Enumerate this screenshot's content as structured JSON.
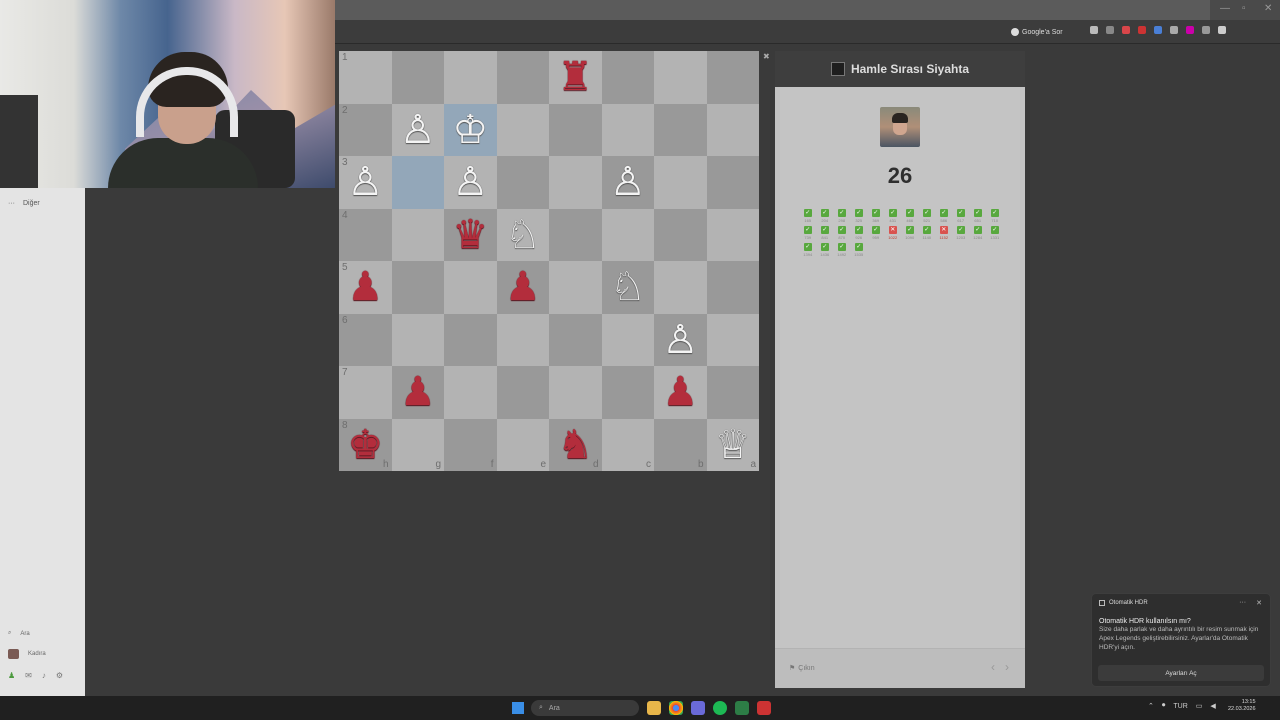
{
  "browser": {
    "google_lens_label": "Google'a Sor",
    "window_controls": [
      "—",
      "▫",
      "✕"
    ]
  },
  "sidebar": {
    "menu_label": "Diğer",
    "search_label": "Ara",
    "user_label": "Kadıra"
  },
  "board": {
    "rank_labels": [
      "1",
      "2",
      "3",
      "4",
      "5",
      "6",
      "7",
      "8"
    ],
    "file_labels": [
      "h",
      "g",
      "f",
      "e",
      "d",
      "c",
      "b",
      "a"
    ],
    "rows": [
      [
        "",
        "",
        "",
        "",
        "♜",
        "",
        "",
        ""
      ],
      [
        "",
        "♙",
        "♔",
        "",
        "",
        "",
        "",
        ""
      ],
      [
        "♙",
        "",
        "♙",
        "",
        "",
        "♙",
        "",
        ""
      ],
      [
        "",
        "",
        "♛",
        "♘",
        "",
        "",
        "",
        ""
      ],
      [
        "♟",
        "",
        "",
        "♟",
        "",
        "♘",
        "",
        ""
      ],
      [
        "",
        "",
        "",
        "",
        "",
        "",
        "♙",
        ""
      ],
      [
        "",
        "♟",
        "",
        "",
        "",
        "",
        "♟",
        ""
      ],
      [
        "♚",
        "",
        "",
        "",
        "♞",
        "",
        "",
        "♕"
      ]
    ],
    "colors": [
      [
        "",
        "",
        "",
        "",
        "b",
        "",
        "",
        ""
      ],
      [
        "",
        "w",
        "w",
        "",
        "",
        "",
        "",
        ""
      ],
      [
        "w",
        "",
        "w",
        "",
        "",
        "w",
        "",
        ""
      ],
      [
        "",
        "",
        "b",
        "w",
        "",
        "",
        "",
        ""
      ],
      [
        "b",
        "",
        "",
        "b",
        "",
        "w",
        "",
        ""
      ],
      [
        "",
        "",
        "",
        "",
        "",
        "",
        "w",
        ""
      ],
      [
        "",
        "b",
        "",
        "",
        "",
        "",
        "b",
        ""
      ],
      [
        "b",
        "",
        "",
        "",
        "b",
        "",
        "",
        "w"
      ]
    ],
    "highlighted": [
      [
        1,
        2
      ],
      [
        2,
        1
      ]
    ]
  },
  "panel": {
    "turn_text": "Hamle Sırası Siyahta",
    "score": "26",
    "moves": [
      {
        "n": "165",
        "ok": true
      },
      {
        "n": "204",
        "ok": true
      },
      {
        "n": "298",
        "ok": true
      },
      {
        "n": "325",
        "ok": true
      },
      {
        "n": "369",
        "ok": true
      },
      {
        "n": "431",
        "ok": true
      },
      {
        "n": "466",
        "ok": true
      },
      {
        "n": "521",
        "ok": true
      },
      {
        "n": "586",
        "ok": true
      },
      {
        "n": "617",
        "ok": true
      },
      {
        "n": "651",
        "ok": true
      },
      {
        "n": "710",
        "ok": true
      },
      {
        "n": "739",
        "ok": true
      },
      {
        "n": "841",
        "ok": true
      },
      {
        "n": "870",
        "ok": true
      },
      {
        "n": "926",
        "ok": true
      },
      {
        "n": "959",
        "ok": true
      },
      {
        "n": "1022",
        "ok": false
      },
      {
        "n": "1090",
        "ok": true
      },
      {
        "n": "1140",
        "ok": true
      },
      {
        "n": "1152",
        "ok": false
      },
      {
        "n": "1203",
        "ok": true
      },
      {
        "n": "1284",
        "ok": true
      },
      {
        "n": "1331",
        "ok": true
      },
      {
        "n": "1394",
        "ok": true
      },
      {
        "n": "1436",
        "ok": true
      },
      {
        "n": "1492",
        "ok": true
      },
      {
        "n": "1535",
        "ok": true
      }
    ],
    "resign_label": "Çıkın",
    "prev_label": "‹",
    "next_label": "›"
  },
  "toast": {
    "app": "Otomatik HDR",
    "title": "Otomatik HDR kullanılsın mı?",
    "body": "Size daha parlak ve daha ayrıntılı bir resim sunmak için Apex Legends geliştirebilirsiniz. Ayarlar'da Otomatik HDR'yi açın.",
    "button": "Ayarları Aç",
    "more": "···",
    "close": "✕"
  },
  "taskbar": {
    "search_placeholder": "Ara",
    "lang": "TUR",
    "time": "13:15",
    "date": "22.03.2026"
  },
  "colors": {
    "white_piece": "#f4f4f4",
    "black_piece": "#b32d3c",
    "move_ok": "#58a83e",
    "move_bad": "#d9534f"
  }
}
